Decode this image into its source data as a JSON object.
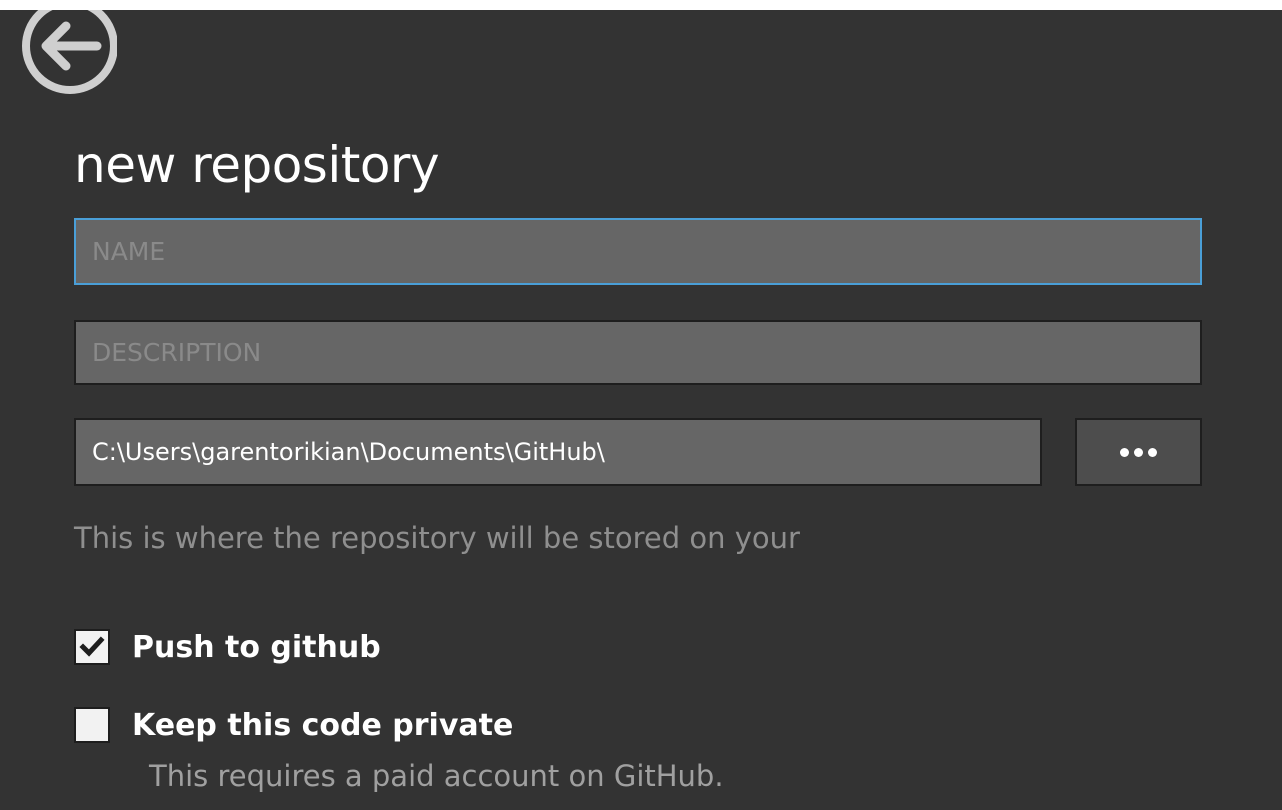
{
  "header": {
    "back_icon": "back-arrow-circle-icon",
    "title": "new repository"
  },
  "form": {
    "name": {
      "value": "",
      "placeholder": "NAME",
      "focused": true
    },
    "description": {
      "value": "",
      "placeholder": "DESCRIPTION"
    },
    "local_path": {
      "value": "C:\\Users\\garentorikian\\Documents\\GitHub\\"
    },
    "browse_button": {
      "icon": "ellipsis-icon"
    },
    "path_hint": "This is where the repository will be stored on your",
    "push_to_github": {
      "label": "Push to github",
      "checked": true
    },
    "keep_private": {
      "label": "Keep this code private",
      "checked": false
    },
    "private_hint": "This requires a paid account on GitHub."
  },
  "colors": {
    "background": "#333333",
    "field_background": "#666666",
    "focus_border": "#4a9fd8",
    "hint_text": "#8f8f8f"
  }
}
